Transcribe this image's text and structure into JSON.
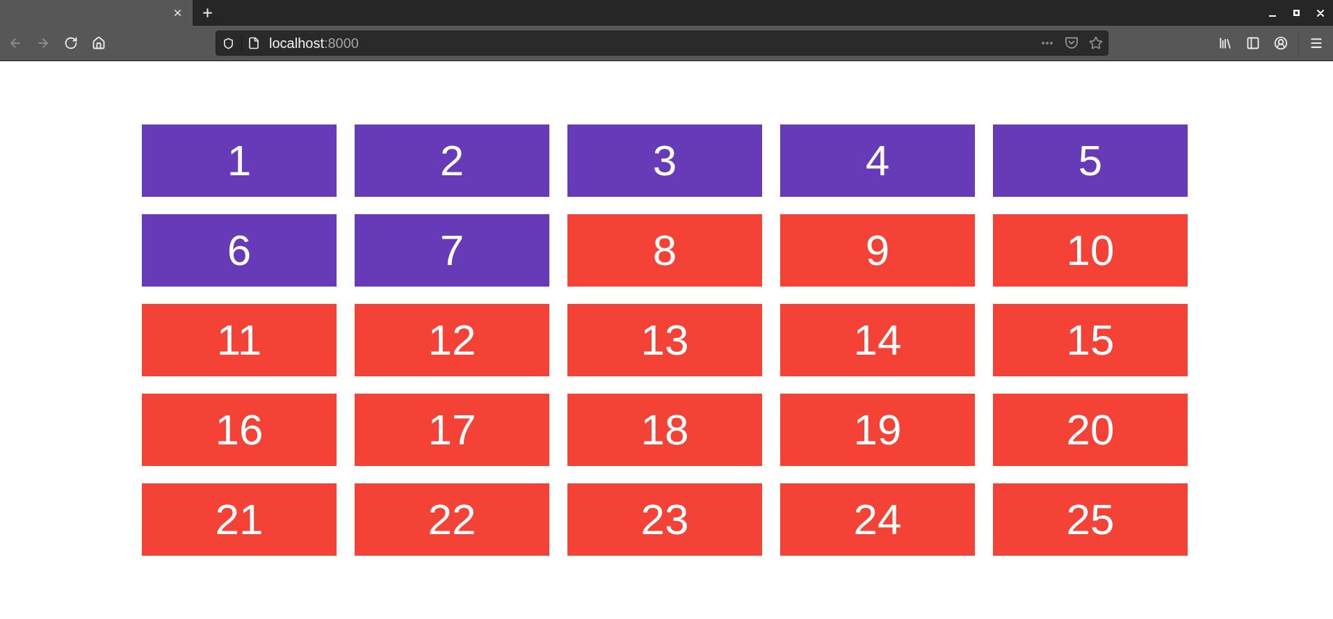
{
  "nav_buttons": [
    {
      "kind": "back",
      "disabled": true
    },
    {
      "kind": "forward",
      "disabled": true
    },
    {
      "kind": "reload",
      "disabled": false
    },
    {
      "kind": "home",
      "disabled": false
    }
  ],
  "address_bar": {
    "host": "localhost",
    "port": ":8000"
  },
  "tiles": [
    {
      "label": "1",
      "color": "#673ab7"
    },
    {
      "label": "2",
      "color": "#673ab7"
    },
    {
      "label": "3",
      "color": "#673ab7"
    },
    {
      "label": "4",
      "color": "#673ab7"
    },
    {
      "label": "5",
      "color": "#673ab7"
    },
    {
      "label": "6",
      "color": "#673ab7"
    },
    {
      "label": "7",
      "color": "#673ab7"
    },
    {
      "label": "8",
      "color": "#f44336"
    },
    {
      "label": "9",
      "color": "#f44336"
    },
    {
      "label": "10",
      "color": "#f44336"
    },
    {
      "label": "11",
      "color": "#f44336"
    },
    {
      "label": "12",
      "color": "#f44336"
    },
    {
      "label": "13",
      "color": "#f44336"
    },
    {
      "label": "14",
      "color": "#f44336"
    },
    {
      "label": "15",
      "color": "#f44336"
    },
    {
      "label": "16",
      "color": "#f44336"
    },
    {
      "label": "17",
      "color": "#f44336"
    },
    {
      "label": "18",
      "color": "#f44336"
    },
    {
      "label": "19",
      "color": "#f44336"
    },
    {
      "label": "20",
      "color": "#f44336"
    },
    {
      "label": "21",
      "color": "#f44336"
    },
    {
      "label": "22",
      "color": "#f44336"
    },
    {
      "label": "23",
      "color": "#f44336"
    },
    {
      "label": "24",
      "color": "#f44336"
    },
    {
      "label": "25",
      "color": "#f44336"
    }
  ]
}
